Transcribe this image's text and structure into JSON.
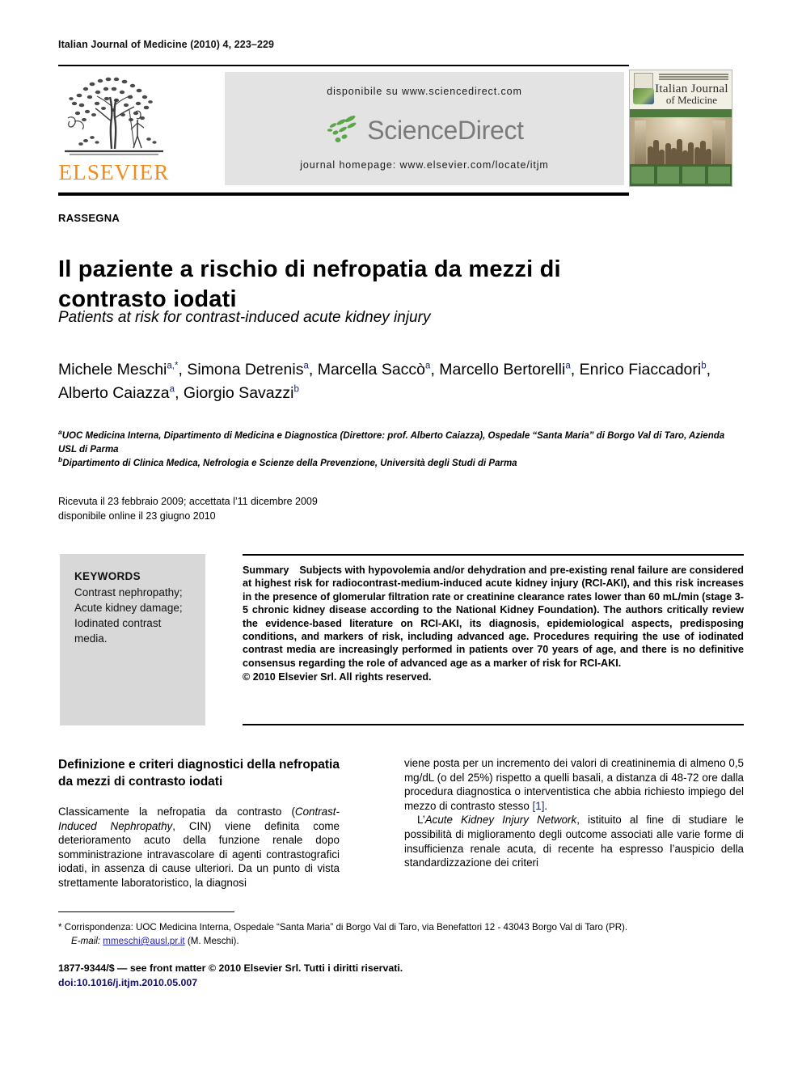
{
  "running_head": "Italian Journal of Medicine (2010) 4, 223–229",
  "masthead": {
    "elsevier_wordmark": "ELSEVIER",
    "available_line": "disponibile su www.sciencedirect.com",
    "sciencedirect_logo_text": "ScienceDirect",
    "homepage_line": "journal homepage: www.elsevier.com/locate/itjm",
    "cover": {
      "title_line1": "Italian Journal",
      "title_line2": "of Medicine"
    }
  },
  "article": {
    "kicker": "RASSEGNA",
    "title": "Il paziente a rischio di nefropatia da mezzi di contrasto iodati",
    "subtitle": "Patients at risk for contrast-induced acute kidney injury"
  },
  "authors": [
    {
      "name": "Michele Meschi",
      "sup": "a,*",
      "sep": ", "
    },
    {
      "name": "Simona Detrenis",
      "sup": "a",
      "sep": ", "
    },
    {
      "name": "Marcella Saccò",
      "sup": "a",
      "sep": ", "
    },
    {
      "name": "Marcello Bertorelli",
      "sup": "a",
      "sep": ", "
    },
    {
      "name": "Enrico Fiaccadori",
      "sup": "b",
      "sep": ", "
    },
    {
      "name": "Alberto Caiazza",
      "sup": "a",
      "sep": ", "
    },
    {
      "name": "Giorgio Savazzi",
      "sup": "b",
      "sep": ""
    }
  ],
  "affiliations": [
    {
      "marker": "a",
      "text": "UOC Medicina Interna, Dipartimento di Medicina e Diagnostica (Direttore: prof. Alberto Caiazza), Ospedale “Santa Maria” di Borgo Val di Taro, Azienda USL di Parma"
    },
    {
      "marker": "b",
      "text": "Dipartimento di Clinica Medica, Nefrologia e Scienze della Prevenzione, Università degli Studi di Parma"
    }
  ],
  "dates": {
    "line1": "Ricevuta il 23 febbraio 2009; accettata l’11 dicembre 2009",
    "line2": "disponibile online il 23 giugno 2010"
  },
  "keywords": {
    "heading": "KEYWORDS",
    "list": "Contrast nephropathy; Acute kidney damage; Iodinated contrast media."
  },
  "summary": {
    "label": "Summary",
    "text": "Subjects with hypovolemia and/or dehydration and pre-existing renal failure are considered at highest risk for radiocontrast-medium-induced acute kidney injury (RCI-AKI), and this risk increases in the presence of glomerular filtration rate or creatinine clearance rates lower than 60 mL/min (stage 3-5 chronic kidney disease according to the National Kidney Foundation). The authors critically review the evidence-based literature on RCI-AKI, its diagnosis, epidemiological aspects, predisposing conditions, and markers of risk, including advanced age. Procedures requiring the use of iodinated contrast media are increasingly performed in patients over 70 years of age, and there is no definitive consensus regarding the role of advanced age as a marker of risk for RCI-AKI.",
    "copyright": "© 2010 Elsevier Srl. All rights reserved."
  },
  "body": {
    "left_heading": "Definizione e criteri diagnostici della nefropatia da mezzi di contrasto iodati",
    "left_p1_a": "Classicamente la nefropatia da contrasto (",
    "left_p1_i1": "Contrast-Induced Nephropathy",
    "left_p1_b": ", CIN) viene definita come deterioramento acuto della funzione renale dopo somministrazione intravascolare di agenti contrastografici iodati, in assenza di cause ulteriori. Da un punto di vista strettamente laboratoristico, la diagnosi",
    "right_p1": "viene posta per un incremento dei valori di creatininemia di almeno 0,5 mg/dL (o del 25%) rispetto a quelli basali, a distanza di 48-72 ore dalla procedura diagnostica o interventistica che abbia richiesto impiego del mezzo di contrasto stesso ",
    "right_p1_cite": "[1]",
    "right_p1_end": ".",
    "right_p2_a": "L’",
    "right_p2_i1": "Acute Kidney Injury Network",
    "right_p2_b": ", istituito al fine di studiare le possibilità di miglioramento degli outcome associati alle varie forme di insufficienza renale acuta, di recente ha espresso l’auspicio della standardizzazione dei criteri"
  },
  "footnote": {
    "line1": "* Corrispondenza: UOC Medicina Interna, Ospedale “Santa Maria” di Borgo Val di Taro, via Benefattori 12 - 43043 Borgo Val di Taro (PR).",
    "email_label": "E-mail: ",
    "email": "mmeschi@ausl.pr.it",
    "email_suffix": " (M. Meschi)."
  },
  "imprint": {
    "line1": "1877-9344/$ — see front matter © 2010 Elsevier Srl. Tutti i diritti riservati.",
    "doi": "doi:10.1016/j.itjm.2010.05.007"
  },
  "colors": {
    "elsevier_orange": "#F08C1B",
    "sciencedirect_green": "#5aa74a",
    "sciencedirect_gray": "#7a7a7a",
    "link_blue": "#2020c0",
    "superscript_blue": "#1b2a6b"
  }
}
